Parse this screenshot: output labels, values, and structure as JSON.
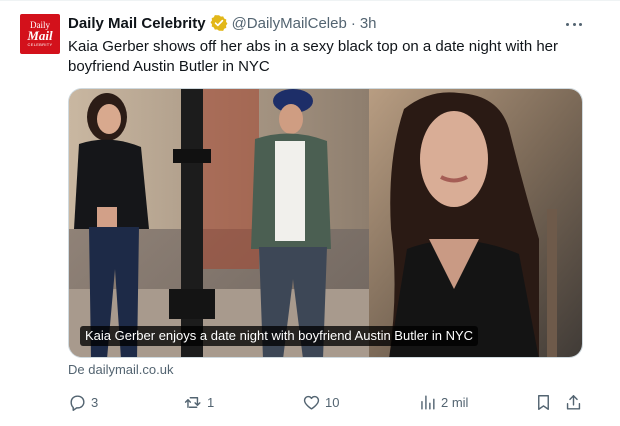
{
  "tweet": {
    "avatar": {
      "line1": "Daily",
      "line2": "Mail",
      "line3": "CELEBRITY",
      "color": "#d3111b"
    },
    "display_name": "Daily Mail Celebrity",
    "verified_badge": "gold-verified-icon",
    "handle": "@DailyMailCeleb",
    "separator": "·",
    "time": "3h",
    "text": "Kaia Gerber shows off her abs in a sexy black top on a date night with her boyfriend Austin Butler in NYC",
    "media_caption": "Kaia Gerber enjoys a date night with boyfriend Austin Butler in NYC",
    "source": "De dailymail.co.uk",
    "actions": {
      "replies": "3",
      "retweets": "1",
      "likes": "10",
      "views": "2 mil"
    }
  },
  "colors": {
    "text_primary": "#0f1419",
    "text_secondary": "#536471",
    "verified_gold": "#e2b719",
    "border": "#cfd9de"
  }
}
